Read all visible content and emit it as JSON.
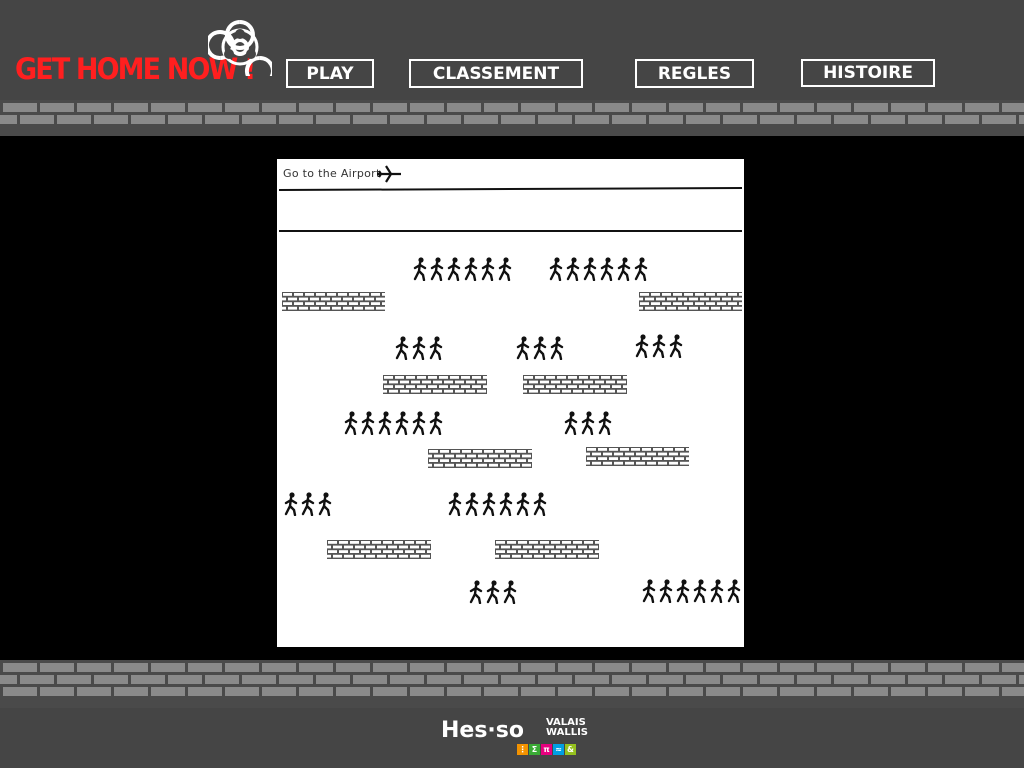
{
  "header": {
    "logo_text": "GET HOME NOW !",
    "logo_icon": "biohazard-icon",
    "logo_color": "#ff1f1f",
    "nav": {
      "play": "PLAY",
      "classement": "CLASSEMENT",
      "regles": "REGLES",
      "histoire": "HISTOIRE"
    }
  },
  "game": {
    "goal_text": "Go to the Airport",
    "goal_icon": "airplane-icon",
    "runner_icon": "running-person-icon",
    "wall_icon": "brick-wall-icon",
    "runner_rows": [
      [
        6,
        6
      ],
      [
        3,
        3,
        3
      ],
      [
        6,
        3
      ],
      [
        3,
        6
      ],
      [
        3,
        6
      ]
    ]
  },
  "footer": {
    "logo_main": "Hes·so",
    "logo_region_1": "VALAIS",
    "logo_region_2": "WALLIS",
    "tiles": [
      {
        "glyph": "⋮",
        "color": "#f39200"
      },
      {
        "glyph": "Σ",
        "color": "#3aaa35"
      },
      {
        "glyph": "π",
        "color": "#e6007e"
      },
      {
        "glyph": "≈",
        "color": "#009fe3"
      },
      {
        "glyph": "&",
        "color": "#95c11f"
      }
    ]
  }
}
